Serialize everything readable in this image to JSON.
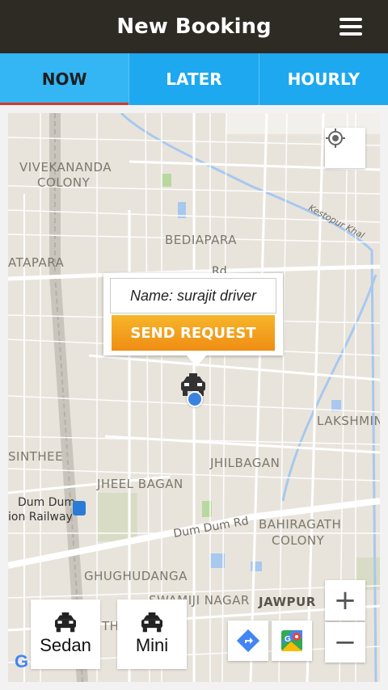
{
  "header": {
    "title": "New Booking",
    "menu_icon": "hamburger-menu-icon"
  },
  "tabs": [
    {
      "label": "NOW",
      "active": true
    },
    {
      "label": "LATER",
      "active": false
    },
    {
      "label": "HOURLY",
      "active": false
    }
  ],
  "map": {
    "areas": [
      "VIVEKANANDA",
      "COLONY",
      "BEDIAPARA",
      "ATAPARA",
      "LAKSHMIN",
      "SINTHEE",
      "JHILBAGAN",
      "JHEEL BAGAN",
      "BAHIRAGATH",
      "COLONY",
      "GHUGHUDANGA",
      "SWAMIJI NAGAR",
      "JAWPUR",
      "TH"
    ],
    "roads": [
      "Kestopur Khal",
      "Dum Dum Rd",
      "Rd"
    ],
    "station": [
      "Dum Dum",
      "ion Railway"
    ],
    "attribution": "G"
  },
  "popup": {
    "name_text": "Name: surajit driver",
    "button_label": "SEND REQUEST"
  },
  "vehicles": [
    {
      "label": "Sedan",
      "icon": "taxi-icon"
    },
    {
      "label": "Mini",
      "icon": "taxi-icon"
    }
  ],
  "controls": {
    "zoom_in": "+",
    "zoom_out": "−"
  },
  "colors": {
    "header_bg": "#2e2b24",
    "tab_bg": "#1ea8f0",
    "tab_active_indicator": "#d8352a",
    "send_button": "#f2a01f"
  }
}
